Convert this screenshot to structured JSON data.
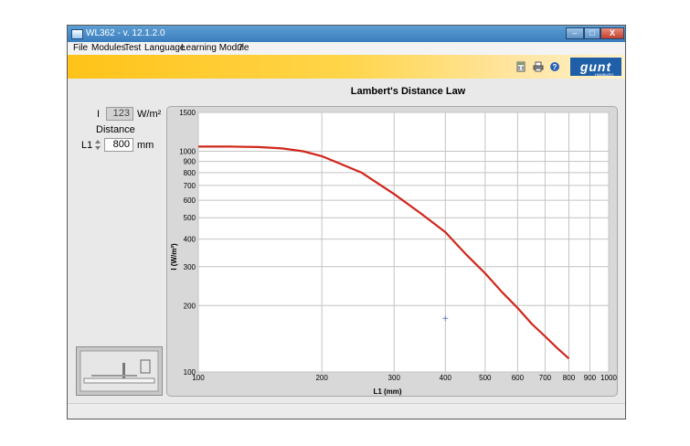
{
  "window": {
    "title": "WL362 - v. 12.1.2.0",
    "minimize_label": "–",
    "maximize_label": "□",
    "close_label": "X"
  },
  "menu": {
    "items": [
      "File",
      "Modules",
      "Test",
      "Language",
      "Learning Module",
      "?"
    ]
  },
  "toolbar": {
    "icons": [
      "calculator-icon",
      "printer-icon",
      "help-icon"
    ],
    "logo_text": "gunt",
    "logo_tag": "HAMBURG"
  },
  "left_panel": {
    "intensity_label": "I",
    "intensity_value": "123",
    "intensity_unit": "W/m²",
    "distance_heading": "Distance",
    "distance_label": "L1",
    "distance_value": "800",
    "distance_unit": "mm"
  },
  "chart_toolbar": {
    "icons": [
      "save-icon",
      "back-icon",
      "zoom-in-icon",
      "zoom-out-icon",
      "forward-icon",
      "close-icon"
    ]
  },
  "colors": {
    "curve": "#d0261c",
    "accent": "#ffc319",
    "marker": "#6a86c8"
  },
  "chart_data": {
    "type": "line",
    "title": "Lambert's Distance Law",
    "xlabel": "L1 (mm)",
    "ylabel": "I (W/m²)",
    "x_scale": "log",
    "y_scale": "log",
    "xlim": [
      100,
      1000
    ],
    "ylim": [
      100,
      1500
    ],
    "grid": true,
    "x_ticks": [
      100,
      200,
      300,
      400,
      500,
      600,
      700,
      800,
      900,
      1000
    ],
    "y_ticks": [
      100,
      200,
      300,
      400,
      500,
      600,
      700,
      800,
      900,
      1000,
      1500
    ],
    "series": [
      {
        "x": [
          100,
          120,
          140,
          160,
          180,
          200,
          250,
          300,
          350,
          400,
          450,
          500,
          550,
          600,
          650,
          700,
          750,
          800
        ],
        "y": [
          1050,
          1050,
          1045,
          1030,
          1000,
          950,
          800,
          640,
          520,
          430,
          340,
          280,
          230,
          195,
          165,
          145,
          128,
          115
        ]
      }
    ],
    "marker": {
      "x": 400,
      "y": 175
    }
  }
}
